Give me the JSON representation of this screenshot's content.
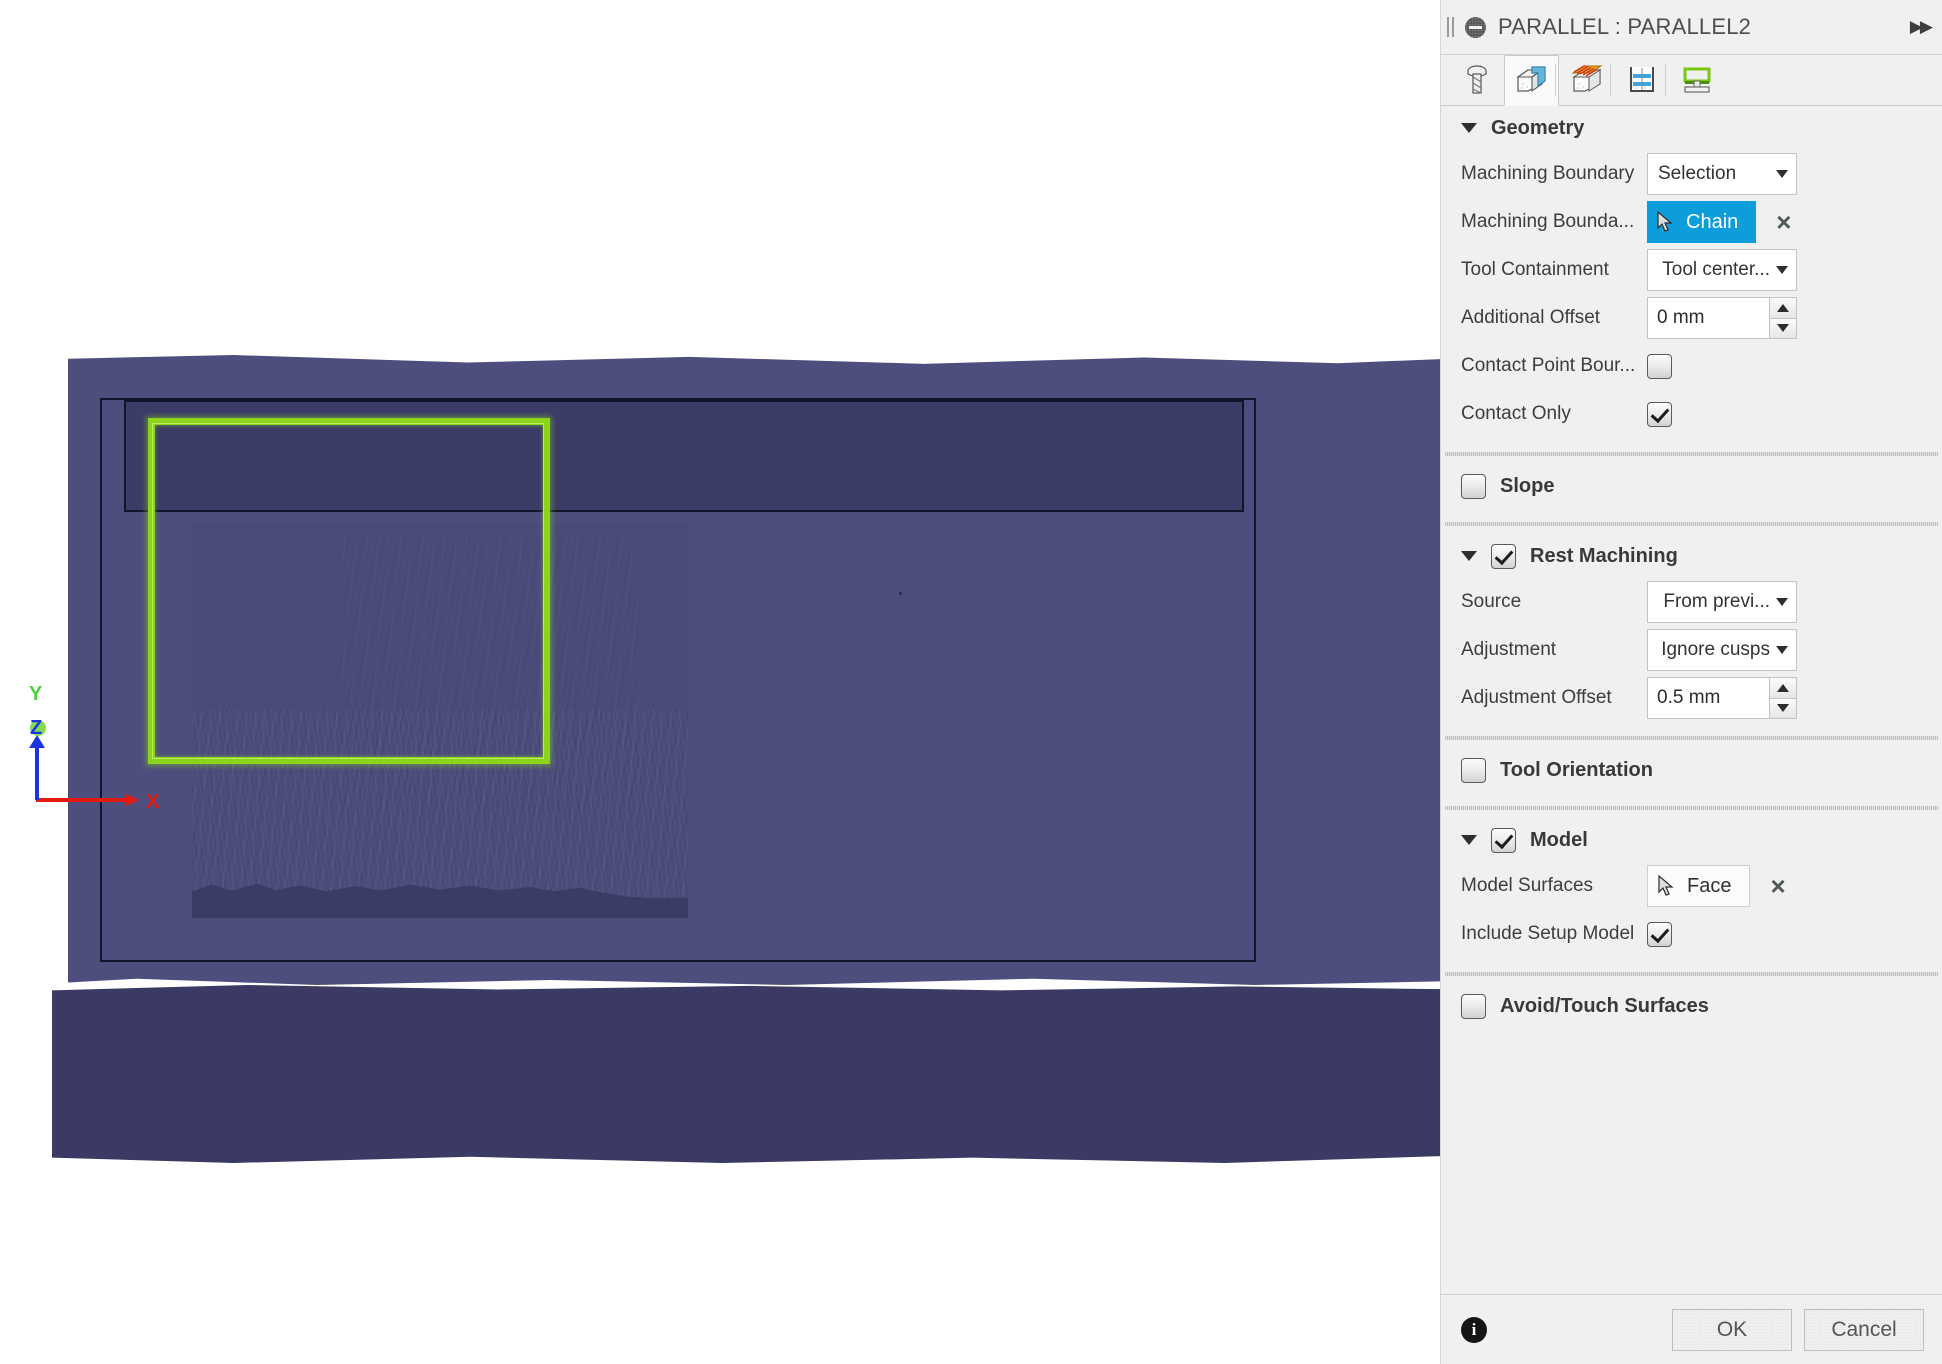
{
  "panel": {
    "title": "PARALLEL : PARALLEL2",
    "collapse_arrows": "▶▶",
    "tabs": [
      {
        "name": "tool-tab",
        "icon": "tool-icon",
        "active": false
      },
      {
        "name": "geometry-tab",
        "icon": "geometry-cube-icon",
        "active": true
      },
      {
        "name": "heights-tab",
        "icon": "heights-cube-icon",
        "active": false
      },
      {
        "name": "passes-tab",
        "icon": "passes-icon",
        "active": false
      },
      {
        "name": "linking-tab",
        "icon": "linking-icon",
        "active": false
      }
    ],
    "sections": {
      "geometry": {
        "title": "Geometry",
        "expanded": true,
        "machining_boundary": {
          "label": "Machining Boundary",
          "value": "Selection"
        },
        "machining_boundary_sel": {
          "label": "Machining Bounda...",
          "value": "Chain",
          "selected": true,
          "clear": "×"
        },
        "tool_containment": {
          "label": "Tool Containment",
          "value": "Tool center..."
        },
        "additional_offset": {
          "label": "Additional Offset",
          "value": "0 mm"
        },
        "contact_point_boundary": {
          "label": "Contact Point Bour...",
          "checked": false
        },
        "contact_only": {
          "label": "Contact Only",
          "checked": true
        }
      },
      "slope": {
        "title": "Slope",
        "checked": false,
        "expanded": false
      },
      "rest_machining": {
        "title": "Rest Machining",
        "checked": true,
        "expanded": true,
        "source": {
          "label": "Source",
          "value": "From previ..."
        },
        "adjustment": {
          "label": "Adjustment",
          "value": "Ignore cusps"
        },
        "adjustment_offset": {
          "label": "Adjustment Offset",
          "value": "0.5 mm"
        }
      },
      "tool_orientation": {
        "title": "Tool Orientation",
        "checked": false,
        "expanded": false
      },
      "model": {
        "title": "Model",
        "checked": true,
        "expanded": true,
        "model_surfaces": {
          "label": "Model Surfaces",
          "value": "Face",
          "clear": "×"
        },
        "include_setup_model": {
          "label": "Include Setup Model",
          "checked": true
        }
      },
      "avoid_touch": {
        "title": "Avoid/Touch Surfaces",
        "checked": false,
        "expanded": false
      }
    },
    "footer": {
      "info": "i",
      "ok_label": "OK",
      "cancel_label": "Cancel"
    }
  },
  "viewport": {
    "axis": {
      "x_label": "X",
      "y_label": "Y",
      "z_label": "Z"
    },
    "colors": {
      "stock_far": "#4d4e7e",
      "stock_near": "#3a3a64",
      "selection_green": "#8cd41a",
      "axis_x": "#e01b10",
      "axis_y": "#4ad13a",
      "axis_z": "#1b35e0",
      "accent_blue": "#0d9ddb"
    }
  }
}
